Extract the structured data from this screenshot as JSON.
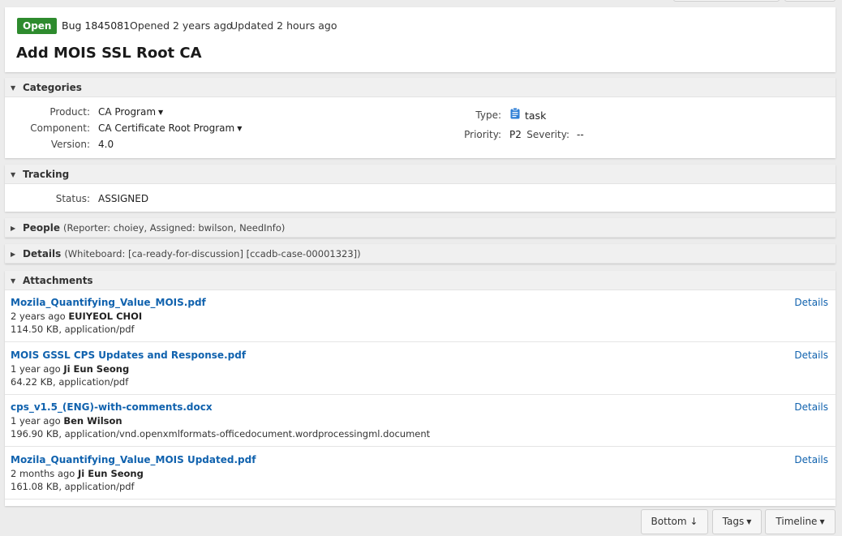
{
  "header": {
    "status_badge": "Open",
    "bug_id": "Bug 1845081",
    "opened": "Opened 2 years ago",
    "updated": "Updated 2 hours ago",
    "title": "Add MOIS SSL Root CA",
    "badge_color": "#2e8b2e"
  },
  "categories": {
    "title": "Categories",
    "product_label": "Product:",
    "product_value": "CA Program",
    "component_label": "Component:",
    "component_value": "CA Certificate Root Program",
    "version_label": "Version:",
    "version_value": "4.0",
    "type_label": "Type:",
    "type_value": "task",
    "type_icon": "clipboard-icon",
    "priority_label": "Priority:",
    "priority_value": "P2",
    "severity_label": "Severity:",
    "severity_value": "--"
  },
  "tracking": {
    "title": "Tracking",
    "status_label": "Status:",
    "status_value": "ASSIGNED"
  },
  "people": {
    "title": "People",
    "summary": "(Reporter: choiey, Assigned: bwilson, NeedInfo)"
  },
  "details": {
    "title": "Details",
    "summary": "(Whiteboard: [ca-ready-for-discussion] [ccadb-case-00001323])"
  },
  "attachments": {
    "title": "Attachments",
    "details_label": "Details",
    "items": [
      {
        "name": "Mozila_Quantifying_Value_MOIS.pdf",
        "age": "2 years ago",
        "author": "EUIYEOL CHOI",
        "size": "114.50 KB, application/pdf"
      },
      {
        "name": "MOIS GSSL CPS Updates and Response.pdf",
        "age": "1 year ago",
        "author": "Ji Eun Seong",
        "size": "64.22 KB, application/pdf"
      },
      {
        "name": "cps_v1.5_(ENG)-with-comments.docx",
        "age": "1 year ago",
        "author": "Ben Wilson",
        "size": "196.90 KB, application/vnd.openxmlformats-officedocument.wordprocessingml.document"
      },
      {
        "name": "Mozila_Quantifying_Value_MOIS Updated.pdf",
        "age": "2 months ago",
        "author": "Ji Eun Seong",
        "size": "161.08 KB, application/pdf"
      }
    ]
  },
  "footer": {
    "bottom_label": "Bottom ↓",
    "tags_label": "Tags",
    "timeline_label": "Timeline"
  },
  "colors": {
    "link": "#1062ae",
    "icon_blue": "#2f7fd6"
  }
}
